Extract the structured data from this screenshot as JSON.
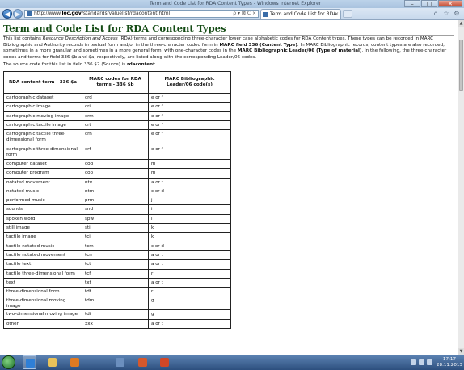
{
  "window": {
    "title": "Term and Code List for RDA Content Types - Windows Internet Explorer",
    "minimize": "–",
    "maximize": "□",
    "close": "✕"
  },
  "browser": {
    "back": "◀",
    "forward": "▶",
    "url_prefix": "http://www.",
    "url_domain": "loc.gov",
    "url_path": "/standards/valuelist/rdacontent.html",
    "address_tools": "ρ ▾ ⊠ C ×",
    "tab_label": "Term and Code List for RDA...",
    "tab_close": "×",
    "home": "⌂",
    "favorites": "☆",
    "tools": "⚙"
  },
  "page": {
    "title": "Term and Code List for RDA Content Types",
    "intro_1": "This list contains ",
    "intro_em": "Resource Description and Access",
    "intro_2": " (RDA) terms and corresponding three-character lower case alphabetic codes for RDA Content types. These types can be recorded in MARC Bibliographic and Authority records in textual form and/or in the three-character coded form in ",
    "intro_b1": "MARC field 336 (Content Type)",
    "intro_3": ". In MARC Bibliographic records, content types are also recorded, sometimes in a more granular and sometimes in a more general form, with one-character codes in the ",
    "intro_b2": "MARC Bibliographic Leader/06 (Type of material)",
    "intro_4": ". In the following, the three-character codes and terms for field 336 $b and $a, respectively, are listed along with the corresponding Leader/06 codes.",
    "source_prefix": "The source code for this list in field 336 $2 (Source) is ",
    "source_code": "rdacontent",
    "source_suffix": "."
  },
  "table": {
    "headers": [
      "RDA content term - 336 $a",
      "MARC codes for RDA terms - 336 $b",
      "MARC Bibliographic Leader/06 code(s)"
    ],
    "rows": [
      {
        "term": "cartographic dataset",
        "code": "crd",
        "leader": "e or f"
      },
      {
        "term": "cartographic image",
        "code": "cri",
        "leader": "e or f"
      },
      {
        "term": "cartographic moving image",
        "code": "crm",
        "leader": "e or f"
      },
      {
        "term": "cartographic tactile image",
        "code": "crt",
        "leader": "e or f"
      },
      {
        "term": "cartographic tactile three-dimensional form",
        "code": "crn",
        "leader": "e or f"
      },
      {
        "term": "cartographic three-dimensional form",
        "code": "crf",
        "leader": "e or f"
      },
      {
        "term": "computer dataset",
        "code": "cod",
        "leader": "m"
      },
      {
        "term": "computer program",
        "code": "cop",
        "leader": "m"
      },
      {
        "term": "notated movement",
        "code": "ntv",
        "leader": "a or t"
      },
      {
        "term": "notated music",
        "code": "ntm",
        "leader": "c or d"
      },
      {
        "term": "performed music",
        "code": "prm",
        "leader": "j"
      },
      {
        "term": "sounds",
        "code": "snd",
        "leader": "i"
      },
      {
        "term": "spoken word",
        "code": "spw",
        "leader": "i"
      },
      {
        "term": "still image",
        "code": "sti",
        "leader": "k"
      },
      {
        "term": "tactile image",
        "code": "tci",
        "leader": "k"
      },
      {
        "term": "tactile notated music",
        "code": "tcm",
        "leader": "c or d"
      },
      {
        "term": "tactile notated movement",
        "code": "tcn",
        "leader": "a or t"
      },
      {
        "term": "tactile text",
        "code": "tct",
        "leader": "a or t"
      },
      {
        "term": "tactile three-dimensional form",
        "code": "tcf",
        "leader": "r"
      },
      {
        "term": "text",
        "code": "txt",
        "leader": "a or t"
      },
      {
        "term": "three-dimensional form",
        "code": "tdf",
        "leader": "r"
      },
      {
        "term": "three-dimensional moving image",
        "code": "tdm",
        "leader": "g"
      },
      {
        "term": "two-dimensional moving image",
        "code": "tdi",
        "leader": "g"
      },
      {
        "term": "other",
        "code": "xxx",
        "leader": "a or t"
      }
    ]
  },
  "taskbar": {
    "apps": [
      {
        "name": "ie",
        "color": "#2f7fd6"
      },
      {
        "name": "explorer",
        "color": "#e8c25a"
      },
      {
        "name": "media-player",
        "color": "#e07a22"
      },
      {
        "name": "marc",
        "color": "#6b8fbe"
      },
      {
        "name": "firefox",
        "color": "#d5582c"
      },
      {
        "name": "powerpoint",
        "color": "#d24726"
      },
      {
        "name": "word",
        "color": "#2b5797"
      }
    ],
    "time": "17:17",
    "date": "28.11.2013"
  }
}
